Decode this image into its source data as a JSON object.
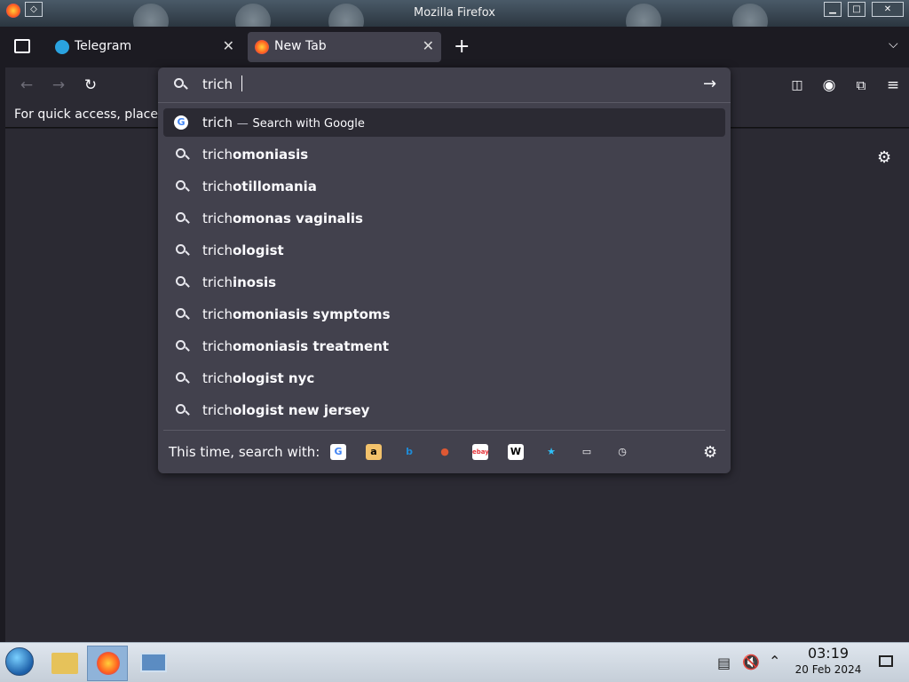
{
  "window": {
    "title": "Mozilla Firefox"
  },
  "tabs": [
    {
      "label": "Telegram",
      "active": false
    },
    {
      "label": "New Tab",
      "active": true
    }
  ],
  "bookmarks_bar": {
    "text": "For quick access, place y"
  },
  "urlbar": {
    "query": "trich",
    "heuristic": {
      "term": "trich",
      "separator": "—",
      "action": "Search with Google"
    },
    "suggestions": [
      {
        "prefix": "trich",
        "rest": "omoniasis"
      },
      {
        "prefix": "trich",
        "rest": "otillomania"
      },
      {
        "prefix": "trich",
        "rest": "omonas vaginalis"
      },
      {
        "prefix": "trich",
        "rest": "ologist"
      },
      {
        "prefix": "trich",
        "rest": "inosis"
      },
      {
        "prefix": "trich",
        "rest": "omoniasis symptoms"
      },
      {
        "prefix": "trich",
        "rest": "omoniasis treatment"
      },
      {
        "prefix": "trich",
        "rest": "ologist nyc"
      },
      {
        "prefix": "trich",
        "rest": "ologist new jersey"
      }
    ],
    "oneoff_label": "This time, search with:",
    "engines": [
      {
        "name": "google-icon",
        "glyph": "G",
        "color": "#4285f4",
        "bg": "#ffffff"
      },
      {
        "name": "amazon-icon",
        "glyph": "a",
        "color": "#000000",
        "bg": "#f3c26b"
      },
      {
        "name": "bing-icon",
        "glyph": "b",
        "color": "#1f8bd6",
        "bg": "transparent"
      },
      {
        "name": "duckduckgo-icon",
        "glyph": "●",
        "color": "#de5833",
        "bg": "transparent"
      },
      {
        "name": "ebay-icon",
        "glyph": "ebay",
        "color": "#e53238",
        "bg": "#ffffff"
      },
      {
        "name": "wikipedia-icon",
        "glyph": "W",
        "color": "#000000",
        "bg": "#ffffff"
      },
      {
        "name": "bookmarks-star-icon",
        "glyph": "★",
        "color": "#2ec0f9",
        "bg": "transparent"
      },
      {
        "name": "tabs-icon",
        "glyph": "▭",
        "color": "#fbfbfe",
        "bg": "transparent"
      },
      {
        "name": "history-icon",
        "glyph": "◷",
        "color": "#fbfbfe",
        "bg": "transparent"
      }
    ]
  },
  "taskbar": {
    "time": "03:19",
    "date": "20 Feb 2024"
  }
}
